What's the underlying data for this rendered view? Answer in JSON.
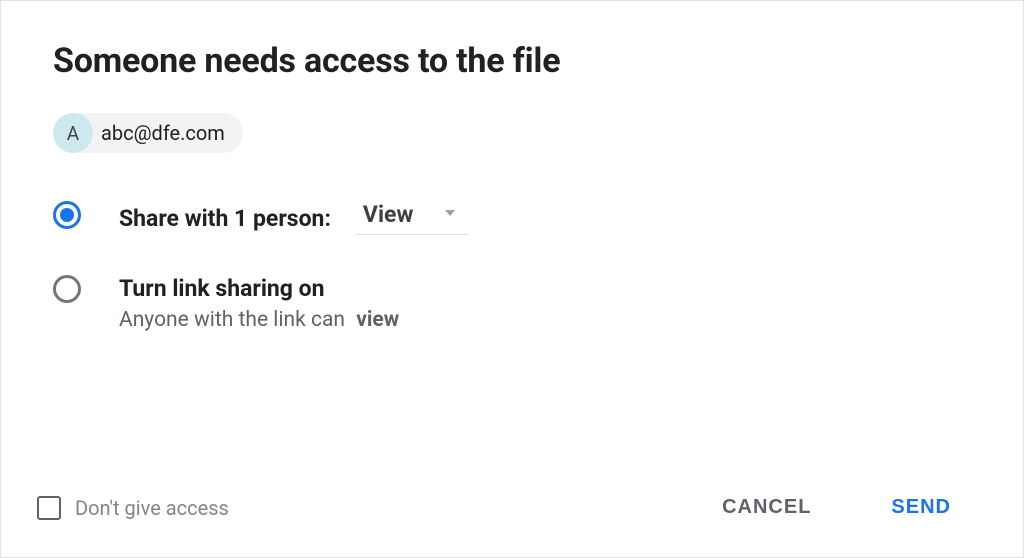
{
  "dialog": {
    "title": "Someone needs access to the file",
    "person": {
      "avatar_initial": "A",
      "email": "abc@dfe.com"
    },
    "option_share": {
      "label": "Share with 1 person:",
      "permission_selected": "View",
      "selected": true
    },
    "option_link": {
      "label": "Turn link sharing on",
      "subtext_prefix": "Anyone with the link can",
      "subtext_permission": "view",
      "selected": false
    },
    "dont_give_label": "Don't give access",
    "buttons": {
      "cancel": "Cancel",
      "send": "Send"
    }
  }
}
